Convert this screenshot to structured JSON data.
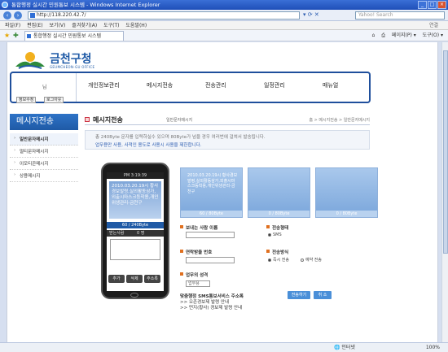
{
  "window": {
    "title": "통합행정 실시간 민원통보 시스템 - Windows Internet Explorer",
    "buttons": [
      "_",
      "□",
      "×"
    ]
  },
  "browser": {
    "url": "http://118.220.42.7/",
    "search_placeholder": "Yahoo! Search",
    "menu": [
      "파일(F)",
      "편집(E)",
      "보기(V)",
      "즐겨찾기(A)",
      "도구(T)",
      "도움말(H)"
    ],
    "menu_right": "연결",
    "tab_title": "통합행정 실시간 민원통보 시스템",
    "cmd": [
      "페이지(P) ▾",
      "도구(O) ▾"
    ],
    "status_done": "",
    "status_zone": "인터넷",
    "zoom": "100%"
  },
  "site": {
    "logo_kr": "금천구청",
    "logo_en": "GEUMCHEON-GU OFFICE"
  },
  "login": {
    "user_suffix": "님",
    "mypage_label": "정보수정",
    "logout_label": "로그아웃"
  },
  "nav": [
    "개인정보관리",
    "메시지전송",
    "전송관리",
    "일정관리",
    "매뉴얼"
  ],
  "sidebar": {
    "title": "메시지전송",
    "items": [
      "일반문자메시지",
      "멀티문자메시지",
      "이모티콘메시지",
      "상용메시지"
    ]
  },
  "content": {
    "title": "메시지전송",
    "subtitle": "일반문자메시지",
    "breadcrumb": "홈 > 메시지전송 > 일반문자메시지",
    "notice_1": "총 240Byte 문자를 입력하실수 있으며 80Byte가 넘을 경우 여러번에 걸쳐서 발송됩니다.",
    "notice_2": "업무용만 사용, 사적인 용도로 사용시 사용을 제한합니다."
  },
  "phone": {
    "status": "PM 3:19:39",
    "message": "2010.03.20.19시 황사경보발령,실외활동삼가,외출시마스크등착용,개인위생관리-금천구",
    "bytes": "60 / 240Byte",
    "sender_label": "받는사람",
    "sender_count": "0 명",
    "buttons": [
      "추가",
      "삭제",
      "주소록"
    ]
  },
  "tiles": [
    {
      "text": "2010.03.20.19시 황사경보발령,실외활동삼가,외출시마스크등착용,개인위생관리-금천구",
      "count": "60 / 80Byte"
    },
    {
      "text": "",
      "count": "0 / 80Byte"
    },
    {
      "text": "",
      "count": "0 / 80Byte"
    }
  ],
  "form": {
    "sender_label": "보내는 사람 이름",
    "phone_label": "연락받을 번호",
    "biz_label": "업무의 성격",
    "biz_select": "업무용",
    "type_label": "전송형태",
    "type_option": "SMS",
    "method_label": "전송방식",
    "method_immediate": "즉시 전송",
    "method_reserve": "예약 전송",
    "send_button": "전송하기",
    "reset_button": "취 소"
  },
  "guide": {
    "head": "맞춤행정 SMS통보서비스 주소록",
    "lines": [
      ">> 오존경보제 발령 안내",
      ">> 먼지(황사) 경보제 발령 안내"
    ]
  }
}
